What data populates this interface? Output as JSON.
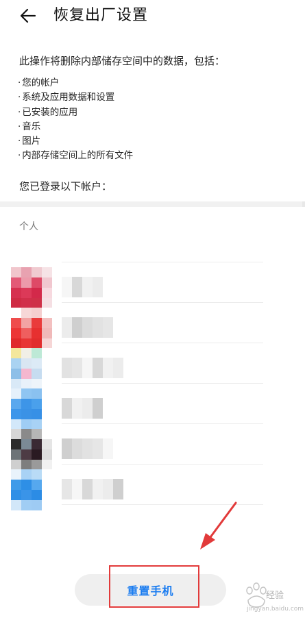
{
  "header": {
    "title": "恢复出厂设置"
  },
  "intro": "此操作将删除内部储存空间中的数据，包括：",
  "bullets": [
    "您的帐户",
    "系统及应用数据和设置",
    "已安装的应用",
    "音乐",
    "图片",
    "内部存储空间上的所有文件"
  ],
  "accounts_heading": "您已登录以下帐户：",
  "section_label": "个人",
  "accounts": [
    {
      "icon_colors": [
        "#f1c6cc",
        "#e8a2b0",
        "#f0cad0",
        "#f6e3e6",
        "#e35a77",
        "#ec9aaa",
        "#de4a67",
        "#f1c7cf",
        "#d6304f",
        "#dc3958",
        "#d3294a",
        "#f7d9df",
        "#cf2b44",
        "#d12f4a",
        "#cf3048",
        "#f5dfe3"
      ]
    },
    {
      "icon_colors": [
        "#ffffff",
        "#f7d7d7",
        "#f5cfcf",
        "#ffffff",
        "#ef4d4d",
        "#f2a3a3",
        "#ea3b3b",
        "#f3c0c0",
        "#ec3636",
        "#ef5f5f",
        "#e73030",
        "#f0b9b9",
        "#e02a2a",
        "#e83535",
        "#e12d2d",
        "#f6d6d6"
      ]
    },
    {
      "icon_colors": [
        "#f4e79c",
        "#f1efe6",
        "#bde9d6",
        "#ffffff",
        "#aad3f2",
        "#d9e6f2",
        "#dceaf6",
        "#ffffff",
        "#8dbfe8",
        "#f4b7cf",
        "#c6dcf0",
        "#ffffff",
        "#d9e9f7",
        "#e8f1fa",
        "#eef4fa",
        "#ffffff"
      ]
    },
    {
      "icon_colors": [
        "#e6f1fb",
        "#8fc5f2",
        "#8ac1f0",
        "#ffffff",
        "#5aa8ee",
        "#3d95e8",
        "#4aa0ec",
        "#ffffff",
        "#3d96ea",
        "#3a92e6",
        "#3790e6",
        "#ffffff",
        "#d3e8fa",
        "#9fcdf4",
        "#a8d2f5",
        "#ffffff"
      ]
    },
    {
      "icon_colors": [
        "#d7d7d7",
        "#8a8a8a",
        "#b6b6b6",
        "#ffffff",
        "#2b2b2b",
        "#7b8a95",
        "#3a2a34",
        "#e5e5e5",
        "#6d7478",
        "#4d3b44",
        "#2a1a22",
        "#dcdcdc",
        "#cfcfcf",
        "#7e7e7e",
        "#9a9a9a",
        "#f1f1f1"
      ]
    },
    {
      "icon_colors": [
        "#e9f3fb",
        "#a9d2f5",
        "#b9dbf6",
        "#ffffff",
        "#3f9be9",
        "#2e8fe6",
        "#56a8ee",
        "#ffffff",
        "#2f8fe6",
        "#3a94e8",
        "#2c8ce5",
        "#ffffff",
        "#d2e7f9",
        "#a0cdf4",
        "#9ecbf3",
        "#ffffff"
      ]
    }
  ],
  "reset_button": "重置手机",
  "watermark": {
    "text": "经验",
    "sub": "jingyan.baidu.com"
  },
  "colors": {
    "accent": "#1a7cf0",
    "annotation": "#e23a3a",
    "band": "#f1f1f1"
  }
}
